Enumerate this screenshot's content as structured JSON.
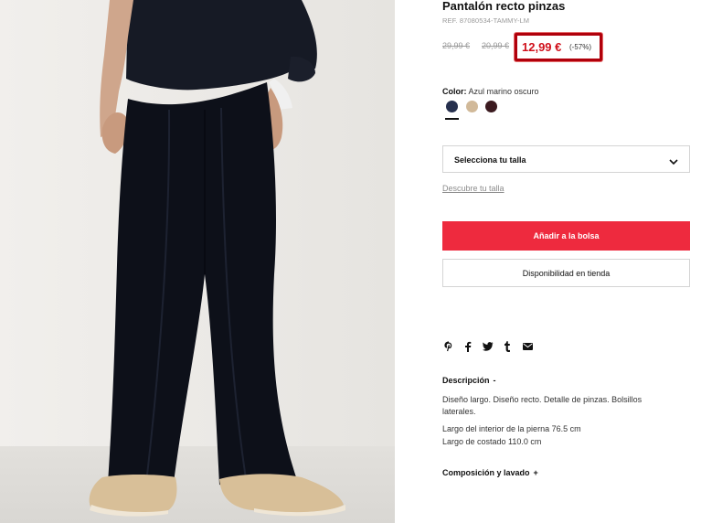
{
  "product": {
    "title": "Pantalón recto pinzas",
    "ref": "REF. 87080534-TAMMY-LM",
    "old_price_1": "29,99 €",
    "old_price_2": "20,99 €",
    "price": "12,99 €",
    "discount": "(-57%)"
  },
  "color": {
    "label": "Color:",
    "value": "Azul marino oscuro",
    "swatches": [
      {
        "name": "swatch-navy",
        "hex": "#26304e",
        "selected": true
      },
      {
        "name": "swatch-beige",
        "hex": "#d1b999",
        "selected": false
      },
      {
        "name": "swatch-burgundy",
        "hex": "#3b1a1f",
        "selected": false
      }
    ]
  },
  "size": {
    "select_label": "Selecciona tu talla",
    "guide_link": "Descubre tu talla"
  },
  "actions": {
    "add_to_bag": "Añadir a la bolsa",
    "store_availability": "Disponibilidad en tienda"
  },
  "share_icons": [
    "pinterest-icon",
    "facebook-icon",
    "twitter-icon",
    "tumblr-icon",
    "email-icon"
  ],
  "description": {
    "heading": "Descripción",
    "sign": "-",
    "text": "Diseño largo. Diseño recto. Detalle de pinzas. Bolsillos laterales.",
    "measure_1": "Largo del interior de la pierna 76.5 cm",
    "measure_2": "Largo de costado 110.0 cm"
  },
  "composition": {
    "heading": "Composición y lavado",
    "sign": "+"
  },
  "colors": {
    "accent_red": "#ee2a3e",
    "price_red": "#d0101b",
    "highlight_border": "#b0000b"
  }
}
